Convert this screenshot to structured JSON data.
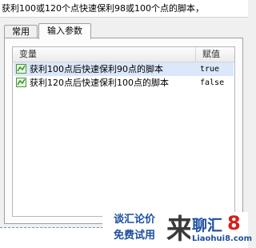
{
  "window": {
    "title": "获利100或120个点快速保利98或100个点的脚本，"
  },
  "tabs": [
    {
      "label": "常用",
      "active": false
    },
    {
      "label": "输入参数",
      "active": true
    }
  ],
  "table": {
    "columns": [
      "变量",
      "赋值"
    ],
    "rows": [
      {
        "name": "获利100点后快速保利90点的脚本",
        "value": "true",
        "selected": true
      },
      {
        "name": "获利120点后快速保利100点的脚本",
        "value": "false",
        "selected": false
      }
    ]
  },
  "ad": {
    "line1": "谈汇论价",
    "line2": "免费试用",
    "mark": "来",
    "brand": "聊汇",
    "brand_num": "8",
    "url": "Liaohui8.com"
  },
  "colors": {
    "selected_row": "#dbe7fa",
    "ad_blue": "#1d4fa0",
    "ad_red": "#d81e1e"
  },
  "icons": {
    "row_icon": "script-parameter-icon"
  }
}
